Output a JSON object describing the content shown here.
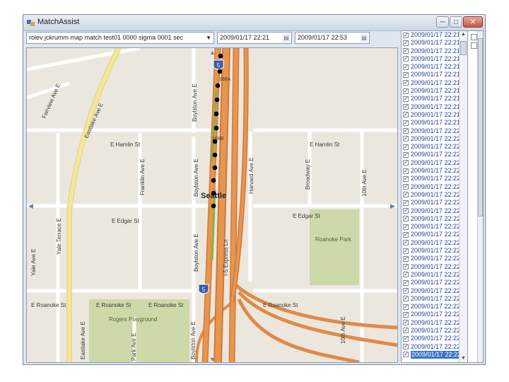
{
  "window": {
    "title": "MatchAssist",
    "minimize_icon": "minimize-icon",
    "maximize_icon": "maximize-icon",
    "close_icon": "close-icon"
  },
  "toolbar": {
    "trace_select": "rolev jckrumm map match test01 0000 sigma 0001 sec",
    "start_time": "2009/01/17 22:21",
    "end_time": "2009/01/17 22:53"
  },
  "map": {
    "streets": {
      "fairview": "Fairview Ave E",
      "eastlake_upper": "Eastlake Ave E",
      "eastlake_lower": "Eastlake Ave E",
      "boylston_upper": "Boylston Ave E",
      "boylston_mid": "Boylston Ave E",
      "boylston_lower": "Boylston Ave E",
      "e_hamlin_left": "E Hamlin St",
      "e_hamlin_right": "E Hamlin St",
      "franklin": "Franklin Ave E",
      "harvard": "Harvard Ave E",
      "broadway": "Broadway E",
      "tenth_upper": "10th Ave E",
      "tenth_lower": "10th Ave E",
      "e_edgar_left": "E Edgar St",
      "e_edgar_right": "E Edgar St",
      "yale": "Yale Terrace E",
      "yale_ave": "Yale Ave E",
      "e_roanoke_1": "E Roanoke St",
      "e_roanoke_2": "E Roanoke St",
      "e_roanoke_3": "E Roanoke St",
      "e_roanoke_4": "E Roanoke St",
      "i5_express": "I-5 Express Ln",
      "park_ave": "Park Ave E"
    },
    "city_label": "Seattle",
    "parks": {
      "roanoke_park": "Roanoke Park",
      "rogers_playground": "Rogers Playground"
    },
    "exits": {
      "exit_168a": "168A",
      "exit_168b": "168B"
    },
    "shields": {
      "interstate_top": "5",
      "interstate_bottom": "5"
    },
    "colors": {
      "background": "#ece7de",
      "highway": "#e08a47",
      "major_road": "#f3df8f",
      "park": "#cdd9a8",
      "gps_point": "#000000"
    }
  },
  "list": {
    "items": [
      "2009/01/17 22:21",
      "2009/01/17 22:21",
      "2009/01/17 22:21",
      "2009/01/17 22:21",
      "2009/01/17 22:21",
      "2009/01/17 22:21",
      "2009/01/17 22:21",
      "2009/01/17 22:21",
      "2009/01/17 22:21",
      "2009/01/17 22:21",
      "2009/01/17 22:21",
      "2009/01/17 22:21",
      "2009/01/17 22:22",
      "2009/01/17 22:22",
      "2009/01/17 22:22",
      "2009/01/17 22:22",
      "2009/01/17 22:22",
      "2009/01/17 22:22",
      "2009/01/17 22:22",
      "2009/01/17 22:22",
      "2009/01/17 22:22",
      "2009/01/17 22:22",
      "2009/01/17 22:22",
      "2009/01/17 22:22",
      "2009/01/17 22:22",
      "2009/01/17 22:22",
      "2009/01/17 22:22",
      "2009/01/17 22:22",
      "2009/01/17 22:22",
      "2009/01/17 22:22",
      "2009/01/17 22:22",
      "2009/01/17 22:22",
      "2009/01/17 22:22",
      "2009/01/17 22:22",
      "2009/01/17 22:22",
      "2009/01/17 22:22",
      "2009/01/17 22:22",
      "2009/01/17 22:22",
      "2009/01/17 22:22",
      "2009/01/17 22:22",
      "2009/01/17 22:22"
    ],
    "selected_index": 40
  }
}
